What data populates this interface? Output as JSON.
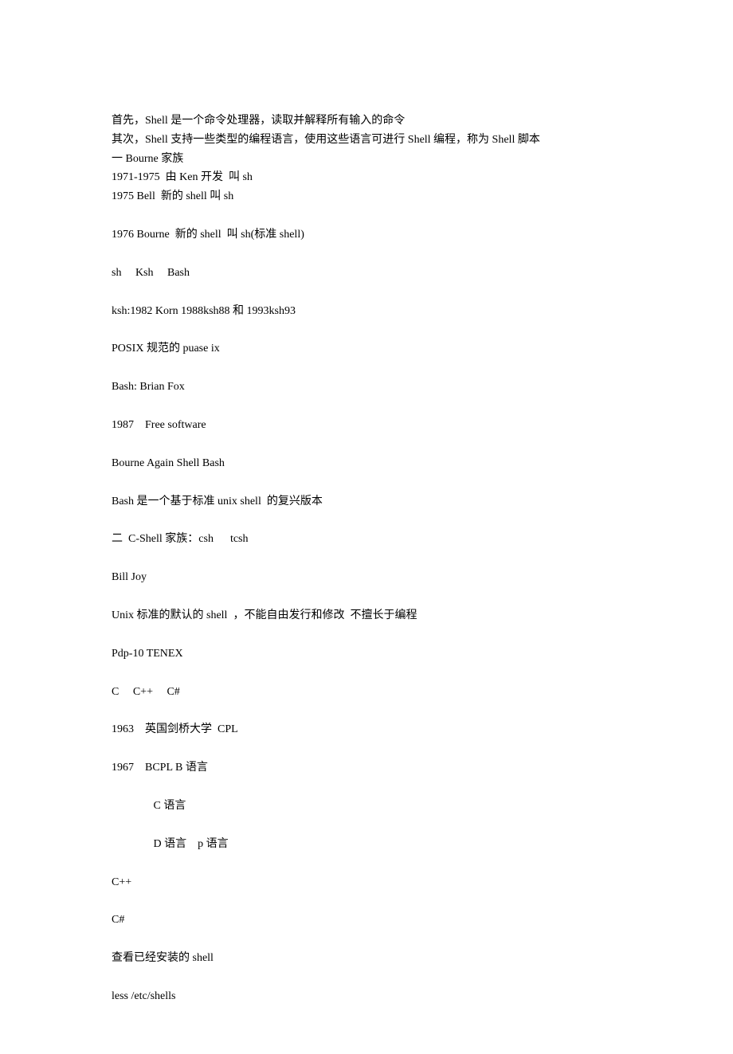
{
  "lines": [
    "首先，Shell 是一个命令处理器，读取并解释所有输入的命令",
    "其次，Shell 支持一些类型的编程语言，使用这些语言可进行 Shell 编程，称为 Shell 脚本",
    "一 Bourne 家族",
    "1971-1975  由 Ken 开发  叫 sh",
    "1975 Bell  新的 shell 叫 sh",
    "",
    "1976 Bourne  新的 shell  叫 sh(标准 shell)",
    "",
    "sh     Ksh     Bash",
    "",
    "ksh:1982 Korn 1988ksh88 和 1993ksh93",
    "",
    "POSIX 规范的 puase ix",
    "",
    "Bash: Brian Fox",
    "",
    "1987    Free software",
    "",
    "Bourne Again Shell Bash",
    "",
    "Bash 是一个基于标准 unix shell  的复兴版本",
    "",
    "二  C-Shell 家族：csh      tcsh",
    "",
    "Bill Joy",
    "",
    "Unix 标准的默认的 shell  ，不能自由发行和修改  不擅长于编程",
    "",
    "Pdp-10 TENEX",
    "",
    "C     C++     C#",
    "",
    "1963    英国剑桥大学  CPL",
    "",
    "1967    BCPL B 语言",
    "",
    "               C 语言",
    "",
    "               D 语言    p 语言",
    "",
    "C++",
    "",
    "C#",
    "",
    "查看已经安装的 shell",
    "",
    "less /etc/shells"
  ]
}
